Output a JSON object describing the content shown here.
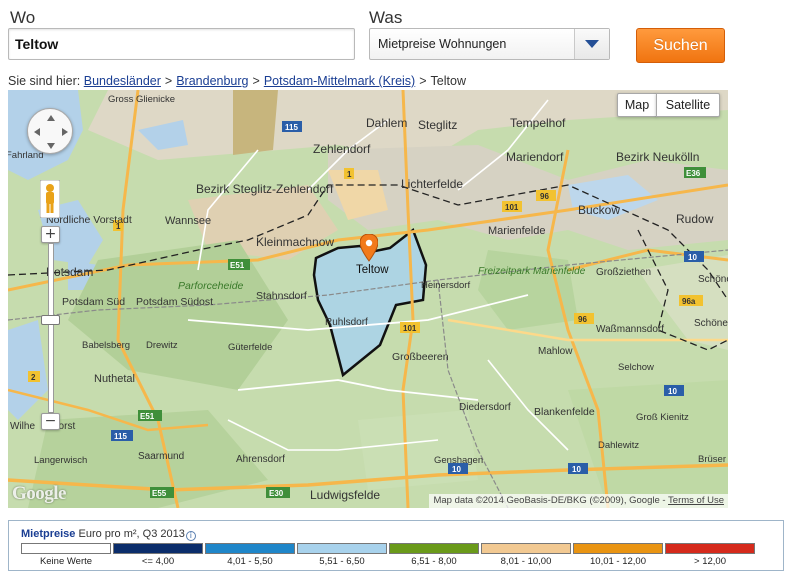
{
  "search": {
    "wo_label": "Wo",
    "wo_value": "Teltow",
    "was_label": "Was",
    "was_value": "Mietpreise Wohnungen",
    "button_label": "Suchen"
  },
  "breadcrumb": {
    "prefix": "Sie sind hier:",
    "links": [
      "Bundesländer",
      "Brandenburg",
      "Potsdam-Mittelmark (Kreis)"
    ],
    "current": "Teltow"
  },
  "map": {
    "type_buttons": [
      "Map",
      "Satellite"
    ],
    "logo": "Google",
    "attribution": "Map data ©2014 GeoBasis-DE/BKG (©2009), Google - ",
    "terms_link": "Terms of Use",
    "place_labels": [
      "Gross Glienicke",
      "Dahlem",
      "Steglitz",
      "Tempelhof",
      "Zehlendorf",
      "Mariendorf",
      "Bezirk Neukölln",
      "Bezirk Steglitz-Zehlendorf",
      "Lichterfelde",
      "Nördliche Vorstadt",
      "Wannsee",
      "Kleinmachnow",
      "Marienfelde",
      "Buckow",
      "Rudow",
      "Potsdam",
      "Teltow",
      "Freizeitpark Marienfelde",
      "Großziethen",
      "Schöne",
      "Parforceheide",
      "Stahnsdorf",
      "Heinersdorf",
      "Potsdam Süd",
      "Potsdam Südost",
      "Ruhlsdorf",
      "Waßmannsdorf",
      "Schönef",
      "Nuthetal",
      "Güterfelde",
      "Großbeeren",
      "Mahlow",
      "Selchow",
      "Diedersdorf",
      "Blankenfelde",
      "Groß Kienitz",
      "Saarmund",
      "Ahrensdorf",
      "Dahlewitz",
      "Langerwisch",
      "Genshagen",
      "Ludwigsfelde",
      "Wilhe",
      "horst",
      "Drewitz",
      "Babelsberg",
      "Fahrland",
      "Brüser"
    ],
    "road_labels": [
      "115",
      "1",
      "E51",
      "101",
      "96",
      "E36",
      "96a",
      "2",
      "10",
      "E30",
      "E55"
    ]
  },
  "legend": {
    "title": "Mietpreise",
    "subtitle": "Euro pro m², Q3 2013",
    "info_icon": "info-icon",
    "items": [
      {
        "label": "Keine Werte",
        "color": "#ffffff"
      },
      {
        "label": "<= 4,00",
        "color": "#0b2d6b"
      },
      {
        "label": "4,01 - 5,50",
        "color": "#1f86c9"
      },
      {
        "label": "5,51 - 6,50",
        "color": "#a8d2ec"
      },
      {
        "label": "6,51 - 8,00",
        "color": "#6a9a1a"
      },
      {
        "label": "8,01 - 10,00",
        "color": "#f2c992"
      },
      {
        "label": "10,01 - 12,00",
        "color": "#e99412"
      },
      {
        "label": "> 12,00",
        "color": "#d52a1c"
      }
    ]
  },
  "colors": {
    "accent": "#f07410",
    "link": "#1a3e93",
    "teltow_fill": "#a8d2ec",
    "boundary": "#111111"
  }
}
